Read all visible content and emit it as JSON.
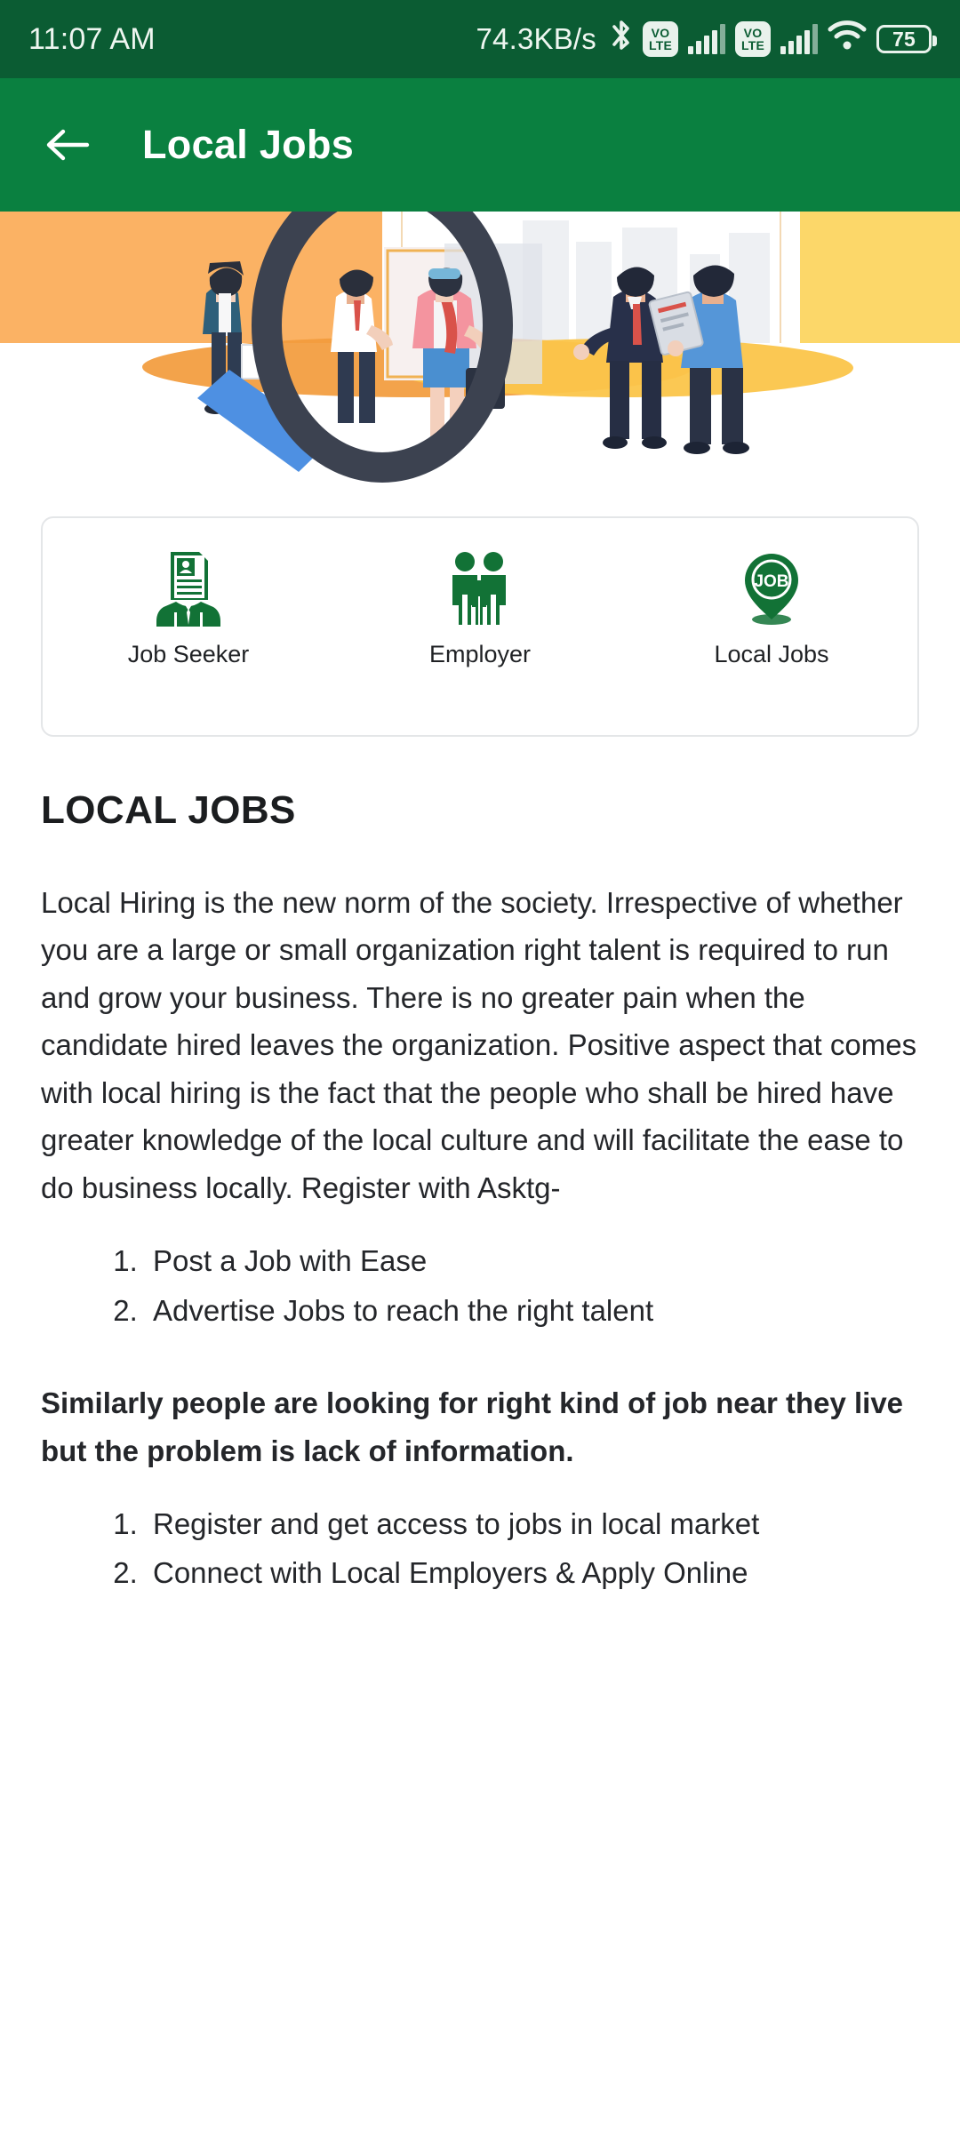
{
  "status_bar": {
    "time": "11:07 AM",
    "net_speed": "74.3KB/s",
    "bluetooth_icon": "bluetooth-icon",
    "volte_top": "VO",
    "volte_bottom": "LTE",
    "wifi_icon": "wifi-icon",
    "battery_level": "75",
    "bg_color": "#0b5c33"
  },
  "app_bar": {
    "back_icon": "arrow-left-icon",
    "title": "Local Jobs",
    "bg_color": "#0a8040"
  },
  "hero": {
    "alt": "job-search-illustration",
    "left_band_color": "#fbb264",
    "right_band_color": "#fcd769",
    "magnifier_color": "#3c4250",
    "handle_color": "#4e90e2"
  },
  "tabs_card": {
    "items": [
      {
        "icon": "resume-person-icon",
        "label": "Job Seeker"
      },
      {
        "icon": "group-people-icon",
        "label": "Employer"
      },
      {
        "icon": "job-map-pin-icon",
        "label": "Local Jobs"
      }
    ],
    "icon_color": "#127236",
    "border_color": "#e4e6e8"
  },
  "article": {
    "heading": "LOCAL JOBS",
    "paragraph_1": "Local Hiring is the new norm of the society. Irrespective of whether you are a large or small organization right talent is required to run and grow your business. There is no greater pain when the candidate hired leaves the organization. Positive aspect that comes with local hiring is the fact that the people who shall be hired have greater knowledge of the local culture and will facilitate the ease to do business locally. Register with Asktg-",
    "list_1": [
      "Post a Job with Ease",
      "Advertise Jobs to reach the right talent"
    ],
    "paragraph_2": "Similarly people are looking for right kind of job near they live but the problem is lack of information.",
    "list_2": [
      "Register and get access to jobs in local market",
      "Connect with Local Employers & Apply Online"
    ]
  }
}
